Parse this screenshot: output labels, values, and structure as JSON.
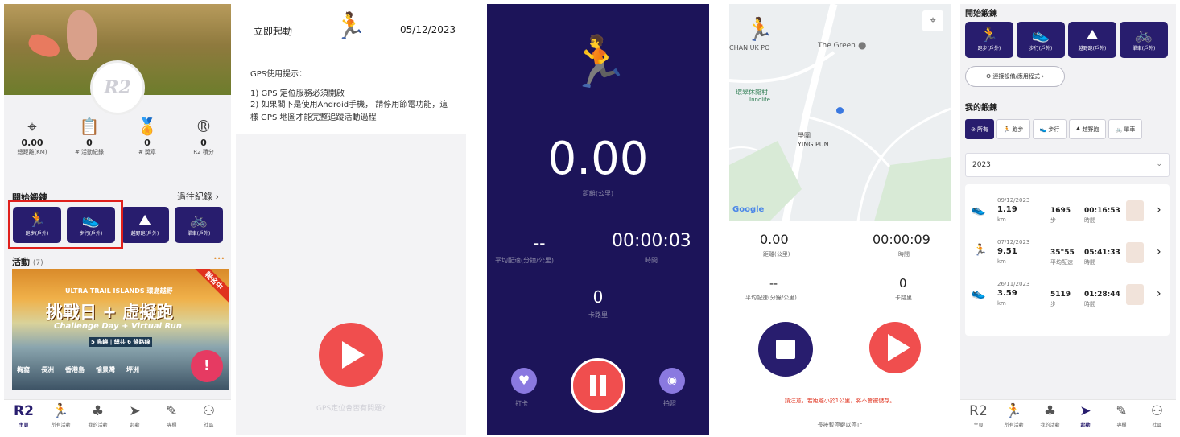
{
  "colors": {
    "brand": "#281d6e",
    "accent": "#f04e4e",
    "dark_bg": "#1c1459"
  },
  "panel1": {
    "stats": [
      {
        "icon": "location-pin-icon",
        "value": "0.00",
        "label": "總距離(KM)"
      },
      {
        "icon": "clipboard-icon",
        "value": "0",
        "label": "# 活動紀錄"
      },
      {
        "icon": "medal-icon",
        "value": "0",
        "label": "# 獎章"
      },
      {
        "icon": "r2-points-icon",
        "value": "0",
        "label": "R2 積分"
      }
    ],
    "start_training": "開始鍛鍊",
    "past_records": "過往紀錄",
    "exercises": [
      {
        "icon": "runner-icon",
        "label": "跑步(戶外)"
      },
      {
        "icon": "shoe-icon",
        "label": "步行(戶外)"
      },
      {
        "icon": "trail-icon",
        "label": "越野跑(戶外)"
      },
      {
        "icon": "bike-icon",
        "label": "單車(戶外)"
      }
    ],
    "activities_title": "活動",
    "activities_count": "(7)",
    "more": "•••",
    "banner": {
      "ribbon": "報名中",
      "top": "ULTRA TRAIL ISLANDS 環島越野",
      "headline": "挑戰日 + 虛擬跑",
      "sub": "Challenge Day + Virtual Run",
      "islands": "5 島嶼 | 總共 6 條路線",
      "places": [
        "梅窩",
        "長洲",
        "香港島",
        "愉景灣",
        "坪洲"
      ]
    },
    "fab": "!"
  },
  "nav": [
    {
      "icon": "r2-logo-icon",
      "label": "主頁"
    },
    {
      "icon": "running-man-icon",
      "label": "所有活動"
    },
    {
      "icon": "tree-icon",
      "label": "我的活動"
    },
    {
      "icon": "send-icon",
      "label": "起動"
    },
    {
      "icon": "pencil-icon",
      "label": "專欄"
    },
    {
      "icon": "community-icon",
      "label": "社區"
    }
  ],
  "panel2": {
    "title": "立即起動",
    "date": "05/12/2023",
    "gps_title": "GPS使用提示：",
    "gps_1": "1) GPS 定位服務必須開啟",
    "gps_2": "2) 如果閣下是使用Android手機， 請停用節電功能，這樣 GPS 地圖才能完整追蹤活動過程",
    "gps_footer": "GPS定位會否有問題?"
  },
  "panel3": {
    "distance": "0.00",
    "distance_label": "距離(公里)",
    "pace": "--",
    "pace_label": "平均配速(分鐘/公里)",
    "time": "00:00:03",
    "time_label": "時間",
    "calories": "0",
    "calories_label": "卡路里",
    "checkin": "打卡",
    "photo": "拍照"
  },
  "panel4": {
    "map": {
      "place1": "The Green",
      "place2": "壆圍\nYING PUN",
      "place3": "CHAN UK PO",
      "place4": "環翠休閒村",
      "place5": "Innolife",
      "google": "Google"
    },
    "distance": "0.00",
    "distance_label": "距離(公里)",
    "time": "00:00:09",
    "time_label": "時間",
    "pace": "--",
    "pace_label": "平均配速(分鐘/公里)",
    "calories": "0",
    "calories_label": "卡路里",
    "warning": "請注意，若距離小於1公里，將不會被儲存。",
    "hint": "長按暫停鍵以停止"
  },
  "panel5": {
    "start_training": "開始鍛鍊",
    "exercises": [
      {
        "icon": "runner-icon",
        "label": "跑步(戶外)"
      },
      {
        "icon": "shoe-icon",
        "label": "步行(戶外)"
      },
      {
        "icon": "trail-icon",
        "label": "越野跑(戶外)"
      },
      {
        "icon": "bike-icon",
        "label": "單車(戶外)"
      }
    ],
    "connect": "連接設備/應用程式",
    "my_training": "我的鍛鍊",
    "filters": [
      "所有",
      "跑步",
      "步行",
      "越野跑",
      "單車"
    ],
    "year": "2023",
    "records": [
      {
        "icon": "shoe-icon",
        "date": "09/12/2023",
        "km": "1.19",
        "km_unit": "km",
        "v2": "1695",
        "v2_label": "步",
        "time": "00:16:53",
        "time_label": "時間"
      },
      {
        "icon": "runner-icon",
        "date": "07/12/2023",
        "km": "9.51",
        "km_unit": "km",
        "v2": "35\"55",
        "v2_label": "平均配速",
        "time": "05:41:33",
        "time_label": "時間"
      },
      {
        "icon": "shoe-icon",
        "date": "26/11/2023",
        "km": "3.59",
        "km_unit": "km",
        "v2": "5119",
        "v2_label": "步",
        "time": "01:28:44",
        "time_label": "時間"
      }
    ]
  }
}
